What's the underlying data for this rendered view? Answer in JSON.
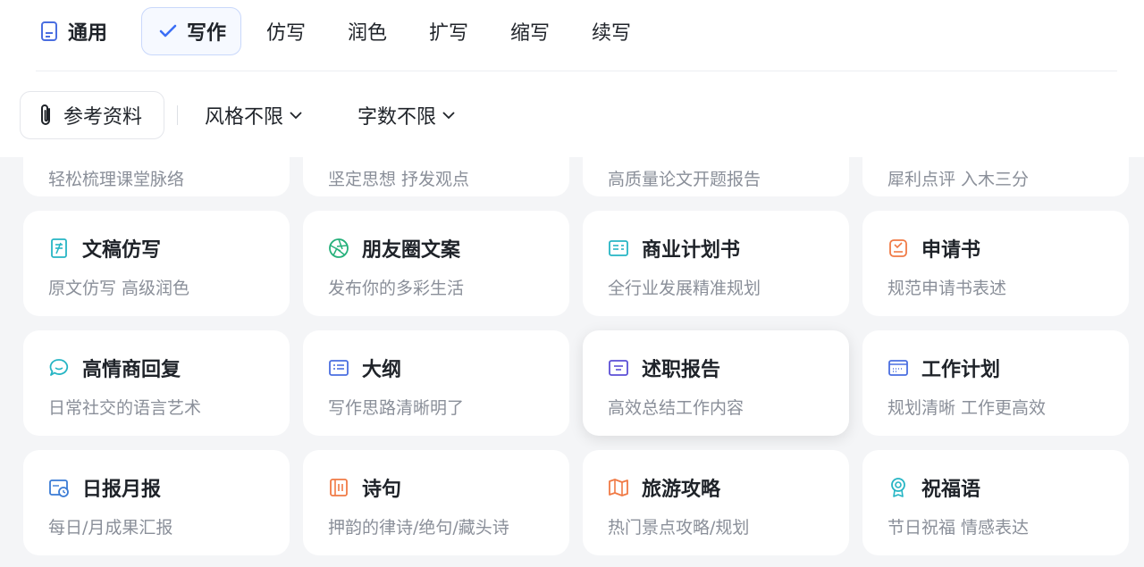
{
  "tabs": {
    "items": [
      {
        "label": "通用"
      },
      {
        "label": "写作"
      },
      {
        "label": "仿写"
      },
      {
        "label": "润色"
      },
      {
        "label": "扩写"
      },
      {
        "label": "缩写"
      },
      {
        "label": "续写"
      }
    ]
  },
  "toolbar": {
    "reference_label": "参考资料",
    "style_dropdown": "风格不限",
    "wordcount_dropdown": "字数不限"
  },
  "partial_row": [
    {
      "desc": "轻松梳理课堂脉络"
    },
    {
      "desc": "坚定思想 抒发观点"
    },
    {
      "desc": "高质量论文开题报告"
    },
    {
      "desc": "犀利点评 入木三分"
    }
  ],
  "cards": [
    {
      "title": "文稿仿写",
      "desc": "原文仿写 高级润色",
      "icon": "document-edit-icon",
      "color": "#26b5c4"
    },
    {
      "title": "朋友圈文案",
      "desc": "发布你的多彩生活",
      "icon": "aperture-icon",
      "color": "#25b07a"
    },
    {
      "title": "商业计划书",
      "desc": "全行业发展精准规划",
      "icon": "business-plan-icon",
      "color": "#26b5c4"
    },
    {
      "title": "申请书",
      "desc": "规范申请书表述",
      "icon": "application-icon",
      "color": "#f07a45"
    },
    {
      "title": "高情商回复",
      "desc": "日常社交的语言艺术",
      "icon": "chat-bubble-icon",
      "color": "#26b5c4"
    },
    {
      "title": "大纲",
      "desc": "写作思路清晰明了",
      "icon": "outline-icon",
      "color": "#4a6ee0"
    },
    {
      "title": "述职报告",
      "desc": "高效总结工作内容",
      "icon": "report-icon",
      "color": "#5b4fd6"
    },
    {
      "title": "工作计划",
      "desc": "规划清晰 工作更高效",
      "icon": "calendar-icon",
      "color": "#4a6ee0"
    },
    {
      "title": "日报月报",
      "desc": "每日/月成果汇报",
      "icon": "daily-report-icon",
      "color": "#3a7bd5"
    },
    {
      "title": "诗句",
      "desc": "押韵的律诗/绝句/藏头诗",
      "icon": "poem-icon",
      "color": "#f07a45"
    },
    {
      "title": "旅游攻略",
      "desc": "热门景点攻略/规划",
      "icon": "map-icon",
      "color": "#f07a45"
    },
    {
      "title": "祝福语",
      "desc": "节日祝福 情感表达",
      "icon": "award-icon",
      "color": "#26b5c4"
    }
  ]
}
